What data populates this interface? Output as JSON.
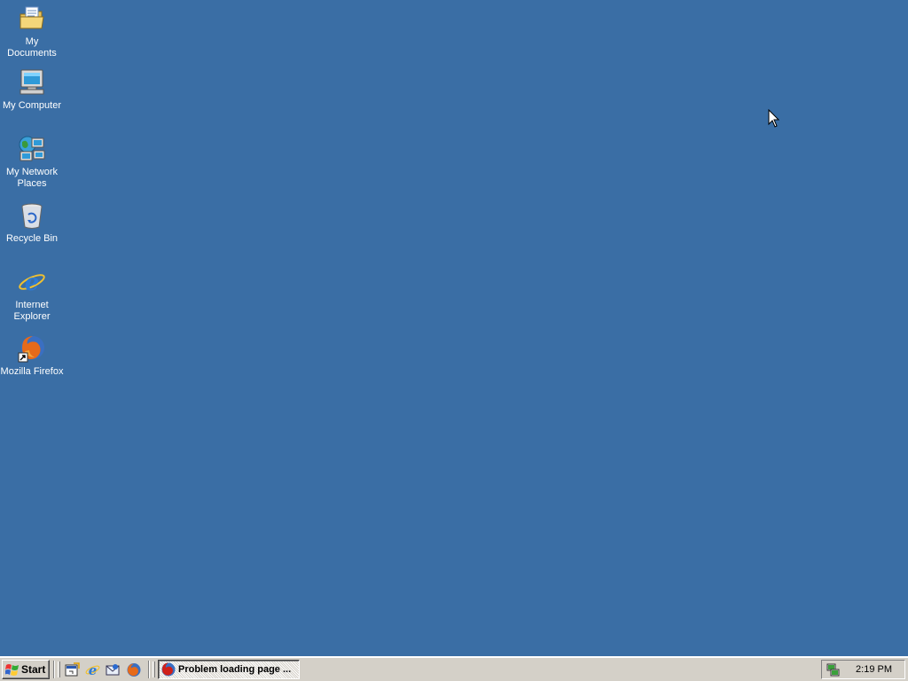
{
  "desktop": {
    "background_color": "#3a6ea5",
    "icons": [
      {
        "label": "My Documents",
        "icon": "folder-documents-icon"
      },
      {
        "label": "My Computer",
        "icon": "computer-icon"
      },
      {
        "label": "My Network Places",
        "icon": "network-places-icon"
      },
      {
        "label": "Recycle Bin",
        "icon": "recycle-bin-icon"
      },
      {
        "label": "Internet Explorer",
        "icon": "internet-explorer-icon"
      },
      {
        "label": "Mozilla Firefox",
        "icon": "firefox-icon"
      }
    ]
  },
  "taskbar": {
    "start_label": "Start",
    "quick_launch": [
      "show-desktop-icon",
      "internet-explorer-icon",
      "outlook-express-icon",
      "firefox-icon"
    ],
    "tasks": [
      {
        "label": "Problem loading page ...",
        "icon": "firefox-icon",
        "active": true
      }
    ],
    "tray": {
      "icons": [
        "network-connection-icon"
      ],
      "clock": "2:19 PM"
    }
  }
}
